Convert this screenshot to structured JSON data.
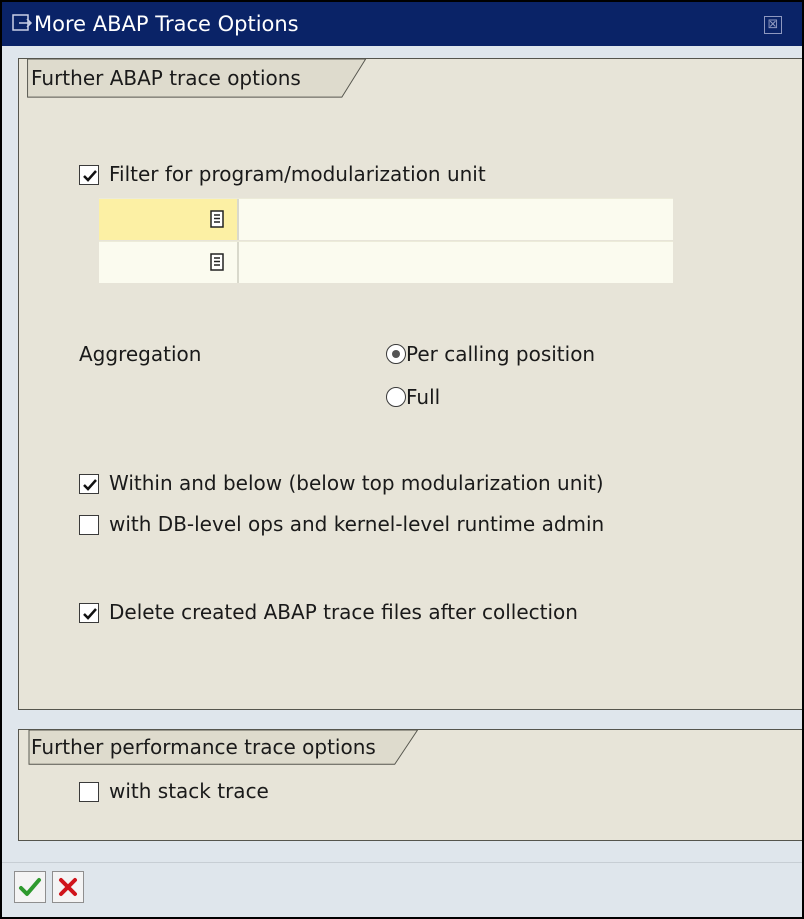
{
  "window": {
    "title": "More ABAP Trace Options",
    "title_icon": "dialog-arrow-icon",
    "close_glyph": "⊠"
  },
  "abap_group": {
    "title": "Further ABAP trace options",
    "filter": {
      "label": "Filter for program/modularization unit",
      "checked": true
    },
    "fields": [
      {
        "key_value": "",
        "desc_value": ""
      },
      {
        "key_value": "",
        "desc_value": ""
      }
    ],
    "aggregation": {
      "label": "Aggregation",
      "options": [
        {
          "label": "Per calling position",
          "selected": true
        },
        {
          "label": "Full",
          "selected": false
        }
      ]
    },
    "within_below": {
      "label": "Within and below (below top modularization unit)",
      "checked": true
    },
    "db_level": {
      "label": "with DB-level ops and kernel-level runtime admin",
      "checked": false
    },
    "delete_files": {
      "label": "Delete created ABAP trace files after collection",
      "checked": true
    }
  },
  "perf_group": {
    "title": "Further performance trace options",
    "stack_trace": {
      "label": "with stack trace",
      "checked": false
    }
  },
  "footer": {
    "confirm_icon": "checkmark-icon",
    "cancel_icon": "cancel-x-icon"
  },
  "colors": {
    "title_bar": "#0a2367",
    "group_bg": "#e7e4d8",
    "dialog_bg": "#dfe6ec",
    "field_focus": "#fcf0a4",
    "field_bg": "#fbfbef",
    "confirm_green": "#2e9a2e",
    "cancel_red": "#d0141b"
  }
}
